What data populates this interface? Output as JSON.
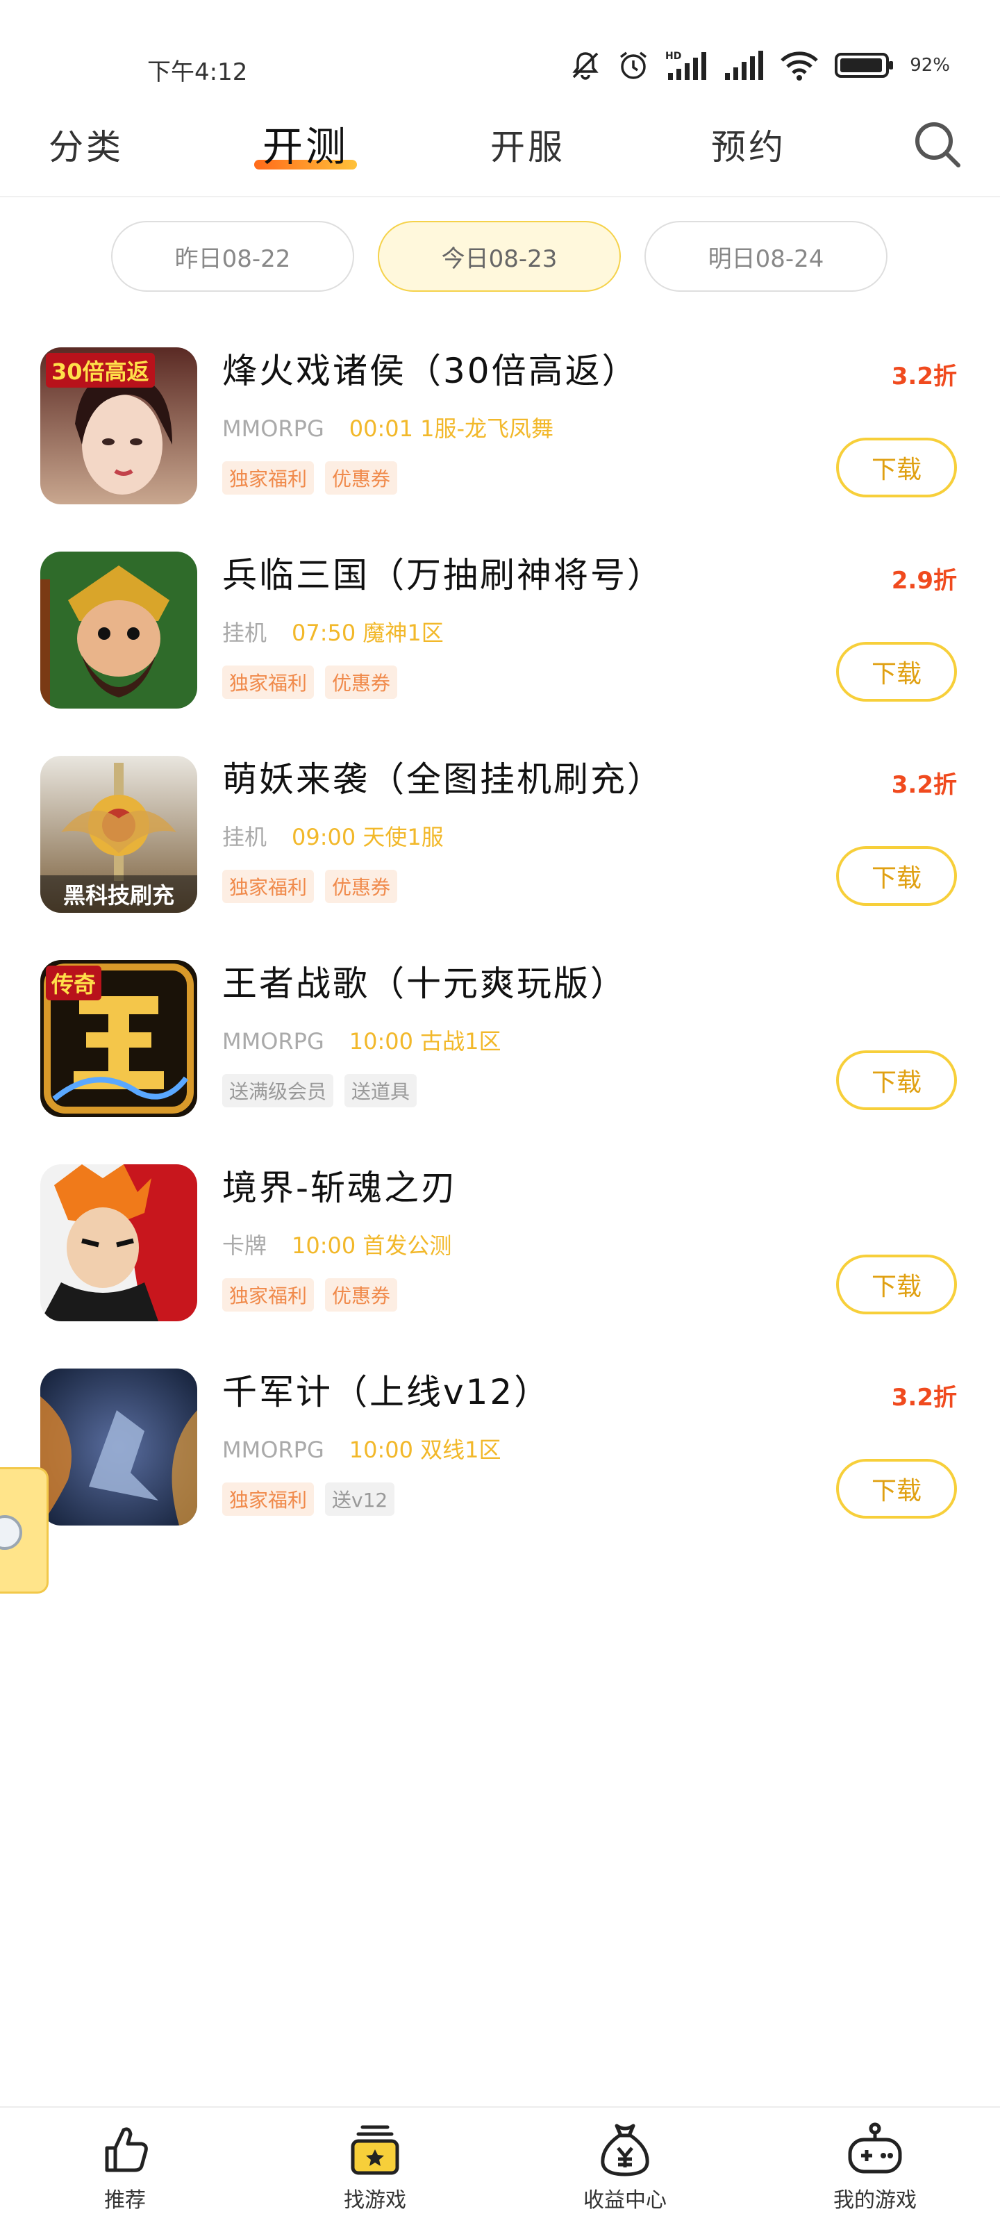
{
  "status_bar": {
    "time": "下午4:12",
    "battery": "92%"
  },
  "top_nav": {
    "tabs": [
      "分类",
      "开测",
      "开服",
      "预约"
    ],
    "active": "开测"
  },
  "date_tabs": [
    {
      "label": "昨日08-22",
      "active": false
    },
    {
      "label": "今日08-23",
      "active": true
    },
    {
      "label": "明日08-24",
      "active": false
    }
  ],
  "games": [
    {
      "title": "烽火戏诸侯（30倍高返）",
      "genre": "MMORPG",
      "open": "00:01 1服-龙飞凤舞",
      "tags": [
        "独家福利",
        "优惠券"
      ],
      "discount": "3.2折",
      "button": "下载",
      "icon_badge": "30倍高返",
      "icon_bottom": ""
    },
    {
      "title": "兵临三国（万抽刷神将号）",
      "genre": "挂机",
      "open": "07:50 魔神1区",
      "tags": [
        "独家福利",
        "优惠券"
      ],
      "discount": "2.9折",
      "button": "下载",
      "icon_badge": "",
      "icon_bottom": ""
    },
    {
      "title": "萌妖来袭（全图挂机刷充）",
      "genre": "挂机",
      "open": "09:00 天使1服",
      "tags": [
        "独家福利",
        "优惠券"
      ],
      "discount": "3.2折",
      "button": "下载",
      "icon_badge": "",
      "icon_bottom": "黑科技刷充"
    },
    {
      "title": "王者战歌（十元爽玩版）",
      "genre": "MMORPG",
      "open": "10:00 古战1区",
      "tags": [
        "送满级会员",
        "送道具"
      ],
      "discount": "",
      "button": "下载",
      "icon_badge": "传奇",
      "icon_bottom": ""
    },
    {
      "title": "境界-斩魂之刃",
      "genre": "卡牌",
      "open": "10:00 首发公测",
      "tags": [
        "独家福利",
        "优惠券"
      ],
      "discount": "",
      "button": "下载",
      "icon_badge": "",
      "icon_bottom": ""
    },
    {
      "title": "千军计（上线v12）",
      "genre": "MMORPG",
      "open": "10:00 双线1区",
      "tags": [
        "独家福利",
        "送v12"
      ],
      "discount": "3.2折",
      "button": "下载",
      "icon_badge": "",
      "icon_bottom": ""
    }
  ],
  "bottom_nav": [
    {
      "label": "推荐",
      "icon": "thumbs-up-icon"
    },
    {
      "label": "找游戏",
      "icon": "game-box-icon"
    },
    {
      "label": "收益中心",
      "icon": "money-bag-icon"
    },
    {
      "label": "我的游戏",
      "icon": "gamepad-icon"
    }
  ],
  "colors": {
    "accent": "#f7cf3a",
    "discount": "#f04a1e",
    "open_time": "#f2b82a"
  }
}
